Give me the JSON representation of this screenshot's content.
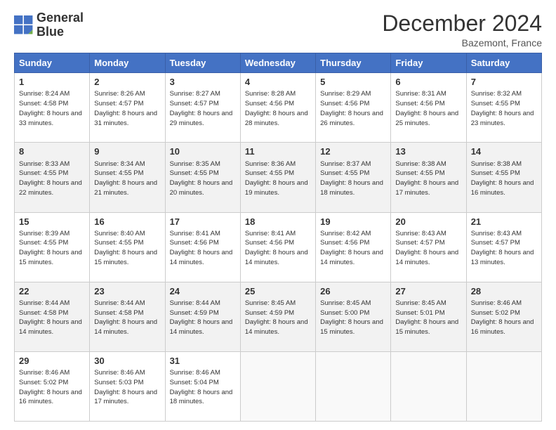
{
  "logo": {
    "line1": "General",
    "line2": "Blue"
  },
  "title": "December 2024",
  "subtitle": "Bazemont, France",
  "days_header": [
    "Sunday",
    "Monday",
    "Tuesday",
    "Wednesday",
    "Thursday",
    "Friday",
    "Saturday"
  ],
  "weeks": [
    [
      {
        "day": "1",
        "rise": "Sunrise: 8:24 AM",
        "set": "Sunset: 4:58 PM",
        "daylight": "Daylight: 8 hours and 33 minutes."
      },
      {
        "day": "2",
        "rise": "Sunrise: 8:26 AM",
        "set": "Sunset: 4:57 PM",
        "daylight": "Daylight: 8 hours and 31 minutes."
      },
      {
        "day": "3",
        "rise": "Sunrise: 8:27 AM",
        "set": "Sunset: 4:57 PM",
        "daylight": "Daylight: 8 hours and 29 minutes."
      },
      {
        "day": "4",
        "rise": "Sunrise: 8:28 AM",
        "set": "Sunset: 4:56 PM",
        "daylight": "Daylight: 8 hours and 28 minutes."
      },
      {
        "day": "5",
        "rise": "Sunrise: 8:29 AM",
        "set": "Sunset: 4:56 PM",
        "daylight": "Daylight: 8 hours and 26 minutes."
      },
      {
        "day": "6",
        "rise": "Sunrise: 8:31 AM",
        "set": "Sunset: 4:56 PM",
        "daylight": "Daylight: 8 hours and 25 minutes."
      },
      {
        "day": "7",
        "rise": "Sunrise: 8:32 AM",
        "set": "Sunset: 4:55 PM",
        "daylight": "Daylight: 8 hours and 23 minutes."
      }
    ],
    [
      {
        "day": "8",
        "rise": "Sunrise: 8:33 AM",
        "set": "Sunset: 4:55 PM",
        "daylight": "Daylight: 8 hours and 22 minutes."
      },
      {
        "day": "9",
        "rise": "Sunrise: 8:34 AM",
        "set": "Sunset: 4:55 PM",
        "daylight": "Daylight: 8 hours and 21 minutes."
      },
      {
        "day": "10",
        "rise": "Sunrise: 8:35 AM",
        "set": "Sunset: 4:55 PM",
        "daylight": "Daylight: 8 hours and 20 minutes."
      },
      {
        "day": "11",
        "rise": "Sunrise: 8:36 AM",
        "set": "Sunset: 4:55 PM",
        "daylight": "Daylight: 8 hours and 19 minutes."
      },
      {
        "day": "12",
        "rise": "Sunrise: 8:37 AM",
        "set": "Sunset: 4:55 PM",
        "daylight": "Daylight: 8 hours and 18 minutes."
      },
      {
        "day": "13",
        "rise": "Sunrise: 8:38 AM",
        "set": "Sunset: 4:55 PM",
        "daylight": "Daylight: 8 hours and 17 minutes."
      },
      {
        "day": "14",
        "rise": "Sunrise: 8:38 AM",
        "set": "Sunset: 4:55 PM",
        "daylight": "Daylight: 8 hours and 16 minutes."
      }
    ],
    [
      {
        "day": "15",
        "rise": "Sunrise: 8:39 AM",
        "set": "Sunset: 4:55 PM",
        "daylight": "Daylight: 8 hours and 15 minutes."
      },
      {
        "day": "16",
        "rise": "Sunrise: 8:40 AM",
        "set": "Sunset: 4:55 PM",
        "daylight": "Daylight: 8 hours and 15 minutes."
      },
      {
        "day": "17",
        "rise": "Sunrise: 8:41 AM",
        "set": "Sunset: 4:56 PM",
        "daylight": "Daylight: 8 hours and 14 minutes."
      },
      {
        "day": "18",
        "rise": "Sunrise: 8:41 AM",
        "set": "Sunset: 4:56 PM",
        "daylight": "Daylight: 8 hours and 14 minutes."
      },
      {
        "day": "19",
        "rise": "Sunrise: 8:42 AM",
        "set": "Sunset: 4:56 PM",
        "daylight": "Daylight: 8 hours and 14 minutes."
      },
      {
        "day": "20",
        "rise": "Sunrise: 8:43 AM",
        "set": "Sunset: 4:57 PM",
        "daylight": "Daylight: 8 hours and 14 minutes."
      },
      {
        "day": "21",
        "rise": "Sunrise: 8:43 AM",
        "set": "Sunset: 4:57 PM",
        "daylight": "Daylight: 8 hours and 13 minutes."
      }
    ],
    [
      {
        "day": "22",
        "rise": "Sunrise: 8:44 AM",
        "set": "Sunset: 4:58 PM",
        "daylight": "Daylight: 8 hours and 14 minutes."
      },
      {
        "day": "23",
        "rise": "Sunrise: 8:44 AM",
        "set": "Sunset: 4:58 PM",
        "daylight": "Daylight: 8 hours and 14 minutes."
      },
      {
        "day": "24",
        "rise": "Sunrise: 8:44 AM",
        "set": "Sunset: 4:59 PM",
        "daylight": "Daylight: 8 hours and 14 minutes."
      },
      {
        "day": "25",
        "rise": "Sunrise: 8:45 AM",
        "set": "Sunset: 4:59 PM",
        "daylight": "Daylight: 8 hours and 14 minutes."
      },
      {
        "day": "26",
        "rise": "Sunrise: 8:45 AM",
        "set": "Sunset: 5:00 PM",
        "daylight": "Daylight: 8 hours and 15 minutes."
      },
      {
        "day": "27",
        "rise": "Sunrise: 8:45 AM",
        "set": "Sunset: 5:01 PM",
        "daylight": "Daylight: 8 hours and 15 minutes."
      },
      {
        "day": "28",
        "rise": "Sunrise: 8:46 AM",
        "set": "Sunset: 5:02 PM",
        "daylight": "Daylight: 8 hours and 16 minutes."
      }
    ],
    [
      {
        "day": "29",
        "rise": "Sunrise: 8:46 AM",
        "set": "Sunset: 5:02 PM",
        "daylight": "Daylight: 8 hours and 16 minutes."
      },
      {
        "day": "30",
        "rise": "Sunrise: 8:46 AM",
        "set": "Sunset: 5:03 PM",
        "daylight": "Daylight: 8 hours and 17 minutes."
      },
      {
        "day": "31",
        "rise": "Sunrise: 8:46 AM",
        "set": "Sunset: 5:04 PM",
        "daylight": "Daylight: 8 hours and 18 minutes."
      },
      null,
      null,
      null,
      null
    ]
  ]
}
